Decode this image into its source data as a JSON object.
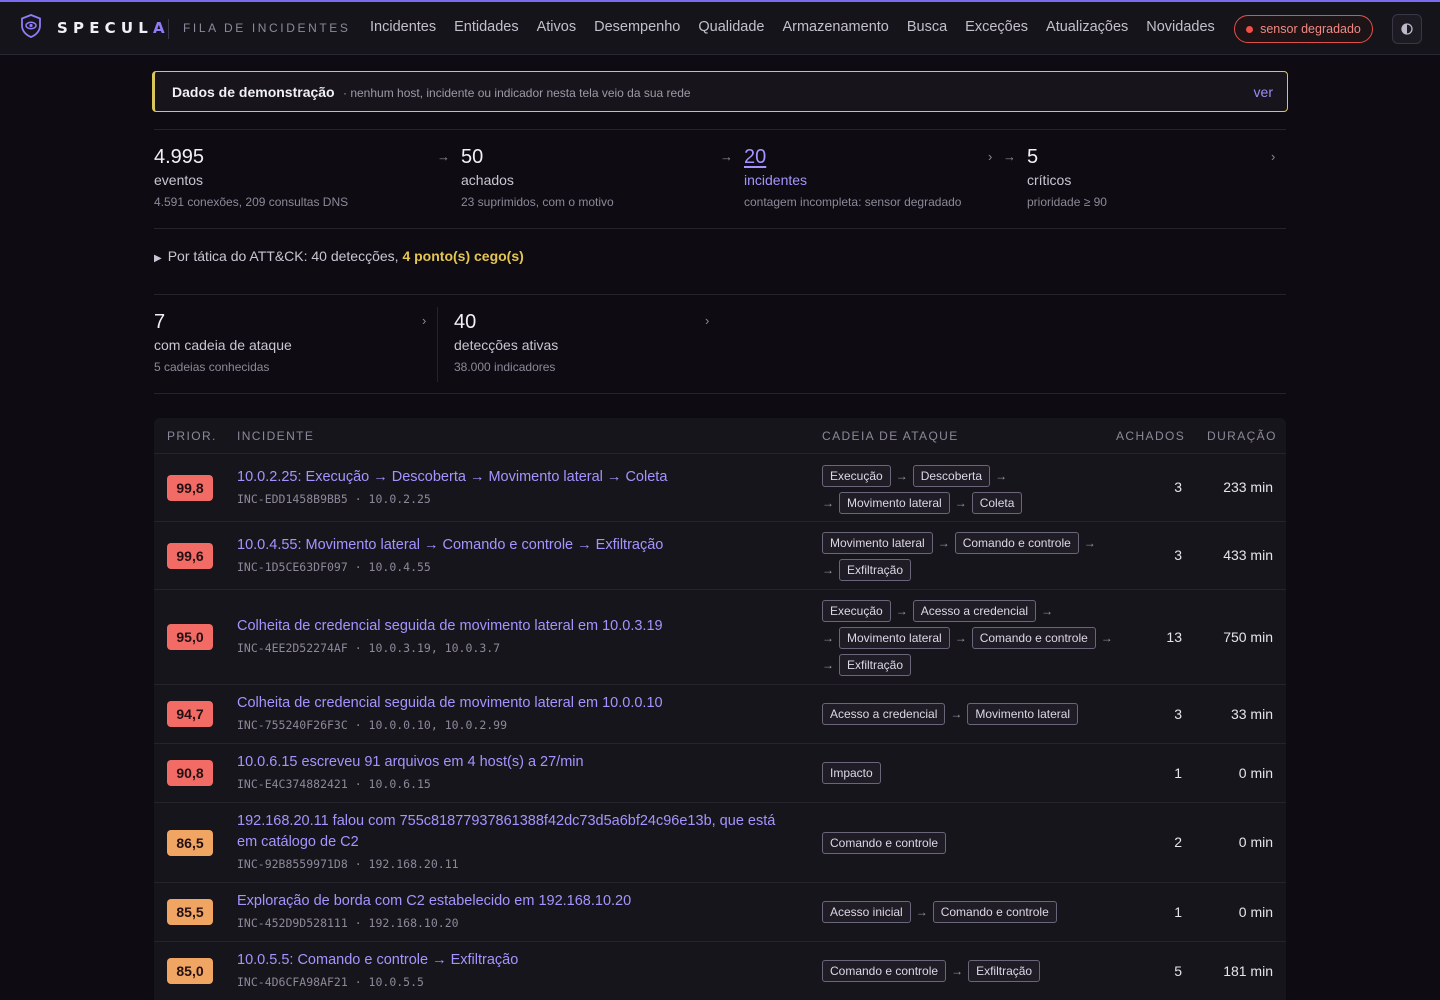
{
  "colors": {
    "accent": "#8f7df7",
    "prio_high": "#f26b65",
    "prio_mid": "#f0a563",
    "warn": "#e4c552",
    "danger": "#ef4f48"
  },
  "header": {
    "brand_main": "SPECUL",
    "brand_accent": "A",
    "subtitle": "FILA DE INCIDENTES",
    "nav": [
      "Incidentes",
      "Entidades",
      "Ativos",
      "Desempenho",
      "Qualidade",
      "Armazenamento",
      "Busca",
      "Exceções",
      "Atualizações",
      "Novidades"
    ],
    "sensor_status": "sensor degradado",
    "theme_icon": "half-circle-icon"
  },
  "banner": {
    "title": "Dados de demonstração",
    "text": "· nenhum host, incidente ou indicador nesta tela veio da sua rede",
    "link": "ver"
  },
  "stats": [
    {
      "value": "4.995",
      "label": "eventos",
      "sub": "4.591 conexões, 209 consultas DNS"
    },
    {
      "value": "50",
      "label": "achados",
      "sub": "23 suprimidos, com o motivo"
    },
    {
      "value": "20",
      "label": "incidentes",
      "sub": "contagem incompleta: sensor degradado"
    },
    {
      "value": "5",
      "label": "críticos",
      "sub": "prioridade ≥ 90"
    }
  ],
  "tactics": {
    "prefix": "Por tática do ATT&CK: 40 detecções,",
    "blind": "4 ponto(s) cego(s)"
  },
  "stats2": [
    {
      "value": "7",
      "label": "com cadeia de ataque",
      "sub": "5 cadeias conhecidas"
    },
    {
      "value": "40",
      "label": "detecções ativas",
      "sub": "38.000 indicadores"
    }
  ],
  "table": {
    "headers": {
      "prio": "PRIOR.",
      "incident": "INCIDENTE",
      "chain": "CADEIA DE ATAQUE",
      "findings": "ACHADOS",
      "duration": "DURAÇÃO"
    },
    "rows": [
      {
        "prio": "99,8",
        "title": "10.0.2.25: Execução → Descoberta → Movimento lateral → Coleta",
        "meta": "INC-EDD1458B9BB5 · 10.0.2.25",
        "chain": [
          [
            "Execução",
            "Descoberta"
          ],
          [
            "Movimento lateral",
            "Coleta"
          ]
        ],
        "findings": "3",
        "duration": "233 min"
      },
      {
        "prio": "99,6",
        "title": "10.0.4.55: Movimento lateral → Comando e controle → Exfiltração",
        "meta": "INC-1D5CE63DF097 · 10.0.4.55",
        "chain": [
          [
            "Movimento lateral",
            "Comando e controle"
          ],
          [
            "Exfiltração"
          ]
        ],
        "findings": "3",
        "duration": "433 min"
      },
      {
        "prio": "95,0",
        "title": "Colheita de credencial seguida de movimento lateral em 10.0.3.19",
        "meta": "INC-4EE2D52274AF · 10.0.3.19, 10.0.3.7",
        "chain": [
          [
            "Execução",
            "Acesso a credencial"
          ],
          [
            "Movimento lateral",
            "Comando e controle"
          ],
          [
            "Exfiltração"
          ]
        ],
        "findings": "13",
        "duration": "750 min"
      },
      {
        "prio": "94,7",
        "title": "Colheita de credencial seguida de movimento lateral em 10.0.0.10",
        "meta": "INC-755240F26F3C · 10.0.0.10, 10.0.2.99",
        "chain": [
          [
            "Acesso a credencial",
            "Movimento lateral"
          ]
        ],
        "findings": "3",
        "duration": "33 min"
      },
      {
        "prio": "90,8",
        "title": "10.0.6.15 escreveu 91 arquivos em 4 host(s) a 27/min",
        "meta": "INC-E4C374882421 · 10.0.6.15",
        "chain": [
          [
            "Impacto"
          ]
        ],
        "findings": "1",
        "duration": "0 min"
      },
      {
        "prio": "86,5",
        "title": "192.168.20.11 falou com 755c81877937861388f42dc73d5a6bf24c96e13b, que está em catálogo de C2",
        "meta": "INC-92B8559971D8 · 192.168.20.11",
        "chain": [
          [
            "Comando e controle"
          ]
        ],
        "findings": "2",
        "duration": "0 min"
      },
      {
        "prio": "85,5",
        "title": "Exploração de borda com C2 estabelecido em 192.168.10.20",
        "meta": "INC-452D9D528111 · 192.168.10.20",
        "chain": [
          [
            "Acesso inicial",
            "Comando e controle"
          ]
        ],
        "findings": "1",
        "duration": "0 min"
      },
      {
        "prio": "85,0",
        "title": "10.0.5.5: Comando e controle → Exfiltração",
        "meta": "INC-4D6CFA98AF21 · 10.0.5.5",
        "chain": [
          [
            "Comando e controle",
            "Exfiltração"
          ]
        ],
        "findings": "5",
        "duration": "181 min"
      }
    ]
  }
}
